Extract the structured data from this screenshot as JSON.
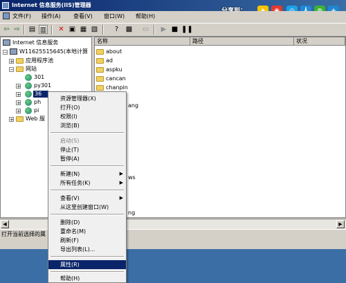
{
  "window": {
    "title": "Internet 信息服务(IIS)管理器"
  },
  "share": {
    "label": "分享到："
  },
  "menu": [
    {
      "label": "文件(F)"
    },
    {
      "label": "操作(A)"
    },
    {
      "label": "查看(V)"
    },
    {
      "label": "窗口(W)"
    },
    {
      "label": "帮助(H)"
    }
  ],
  "tree": {
    "root": "Internet 信息服务",
    "computer": "W11625515645(本地计算",
    "app_pools": "应用程序池",
    "websites": "网站",
    "site1": "301",
    "site2": "py301",
    "site3": "36",
    "site4": "ph",
    "site5": "pi",
    "web_ext": "Web 服"
  },
  "list": {
    "columns": [
      "名称",
      "路径",
      "状况"
    ],
    "rows": [
      "about",
      "ad",
      "aspku",
      "cancan",
      "chanpin"
    ],
    "partial": [
      "ang",
      "ws",
      "ng"
    ]
  },
  "context_menu": {
    "items": [
      {
        "label": "资源管理器(X)"
      },
      {
        "label": "打开(O)"
      },
      {
        "label": "权限(I)"
      },
      {
        "label": "浏览(B)"
      },
      {
        "label": "启动(S)"
      },
      {
        "label": "停止(T)"
      },
      {
        "label": "暂停(A)"
      },
      {
        "label": "新建(N)"
      },
      {
        "label": "所有任务(K)"
      },
      {
        "label": "查看(V)"
      },
      {
        "label": "从这里创建窗口(W)"
      },
      {
        "label": "删除(D)"
      },
      {
        "label": "重命名(M)"
      },
      {
        "label": "刷新(F)"
      },
      {
        "label": "导出列表(L)..."
      },
      {
        "label": "属性(R)"
      },
      {
        "label": "帮助(H)"
      }
    ]
  },
  "status": {
    "text": "打开当前选择的属"
  },
  "colors": {
    "title_start": "#0a246a",
    "title_end": "#3a6ea5",
    "highlight": "#0a246a",
    "desktop": "#3a6ea5"
  }
}
